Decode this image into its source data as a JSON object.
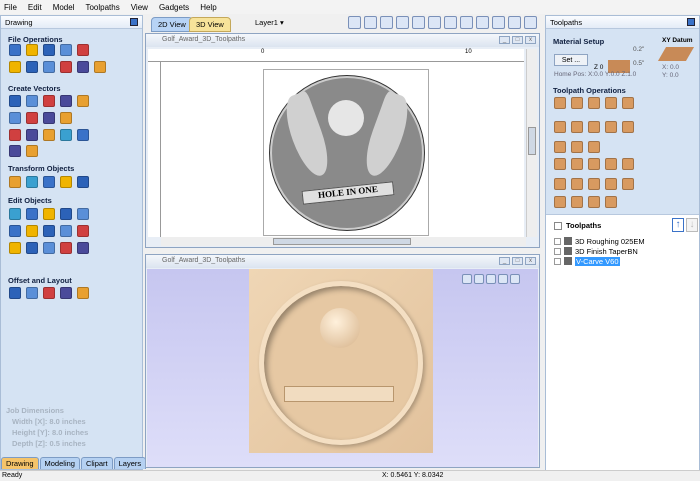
{
  "menu": [
    "File",
    "Edit",
    "Model",
    "Toolpaths",
    "View",
    "Gadgets",
    "Help"
  ],
  "left_panel": {
    "title": "Drawing",
    "sections": {
      "file": "File Operations",
      "create": "Create Vectors",
      "transform": "Transform Objects",
      "edit": "Edit Objects",
      "offset": "Offset and Layout"
    },
    "job": {
      "title": "Job Dimensions",
      "width": "Width  [X]: 8.0 inches",
      "height": "Height [Y]: 8.0 inches",
      "depth": "Depth  [Z]: 0.5 inches"
    },
    "tabs": [
      "Drawing",
      "Modeling",
      "Clipart",
      "Layers"
    ]
  },
  "view_tabs": [
    "2D View",
    "3D View"
  ],
  "layer": "Layer1 ▾",
  "view2d": {
    "title": "Golf_Award_3D_Toolpaths",
    "ruler": [
      "0",
      "10"
    ],
    "banner": "HOLE IN ONE"
  },
  "view3d": {
    "title": "Golf_Award_3D_Toolpaths"
  },
  "right_panel": {
    "title": "Toolpaths",
    "material": {
      "title": "Material Setup",
      "set_button": "Set ...",
      "dim_top": "0.2\"",
      "dim_bottom": "0.5\"",
      "z0": "Z 0",
      "home": "Home Pos:  X:0.0 Y:0.0 Z:1.0"
    },
    "datum": {
      "title": "XY Datum",
      "x": "X: 0.0",
      "y": "Y: 0.0"
    },
    "ops_title": "Toolpath Operations",
    "list_title": "Toolpaths",
    "toolpaths": [
      {
        "name": "3D Roughing 025EM",
        "selected": false
      },
      {
        "name": "3D Finish TaperBN",
        "selected": false
      },
      {
        "name": "V-Carve V60",
        "selected": true
      }
    ]
  },
  "status": {
    "text": "Ready",
    "coords": "X: 0.5461 Y: 8.0342"
  },
  "colors": {
    "panel": "#d5e3f3",
    "accent": "#3399ff",
    "wood": "#e8c9a4",
    "bg3d": "#c9c9f2"
  }
}
